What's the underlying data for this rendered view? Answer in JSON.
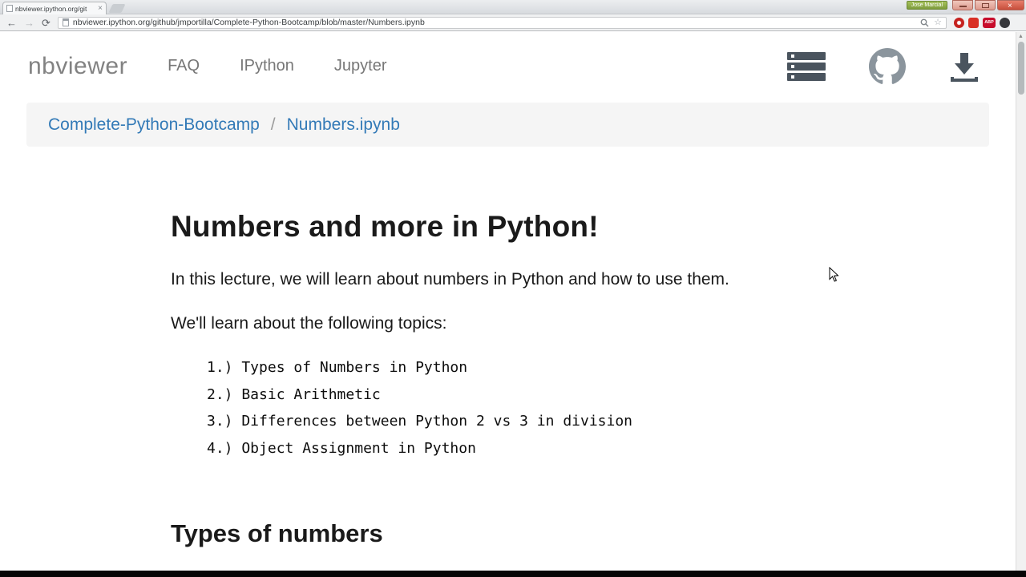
{
  "browser": {
    "tab_title": "nbviewer.ipython.org/git",
    "url": "nbviewer.ipython.org/github/jmportilla/Complete-Python-Bootcamp/blob/master/Numbers.ipynb",
    "user_badge": "Jose Marcial",
    "adblock_badge": "ABP"
  },
  "icons": {
    "back": "←",
    "forward": "→",
    "refresh": "⟳",
    "star": "☆",
    "close_tab": "×",
    "close_window": "×",
    "scroll_up": "▲"
  },
  "site_header": {
    "brand": "nbviewer",
    "nav": [
      {
        "label": "FAQ"
      },
      {
        "label": "IPython"
      },
      {
        "label": "Jupyter"
      }
    ]
  },
  "breadcrumb": {
    "repo": "Complete-Python-Bootcamp",
    "separator": "/",
    "file": "Numbers.ipynb"
  },
  "notebook": {
    "title": "Numbers and more in Python!",
    "intro": "In this lecture, we will learn about numbers in Python and how to use them.",
    "topics_lead": "We'll learn about the following topics:",
    "topics": [
      "1.) Types of Numbers in Python",
      "2.) Basic Arithmetic",
      "3.) Differences between Python 2 vs 3 in division",
      "4.) Object Assignment in Python"
    ],
    "section_title": "Types of numbers"
  },
  "colors": {
    "link": "#337ab7",
    "breadcrumb_bg": "#f5f5f5",
    "header_text": "#777777",
    "icon_gray": "#4a545e"
  }
}
